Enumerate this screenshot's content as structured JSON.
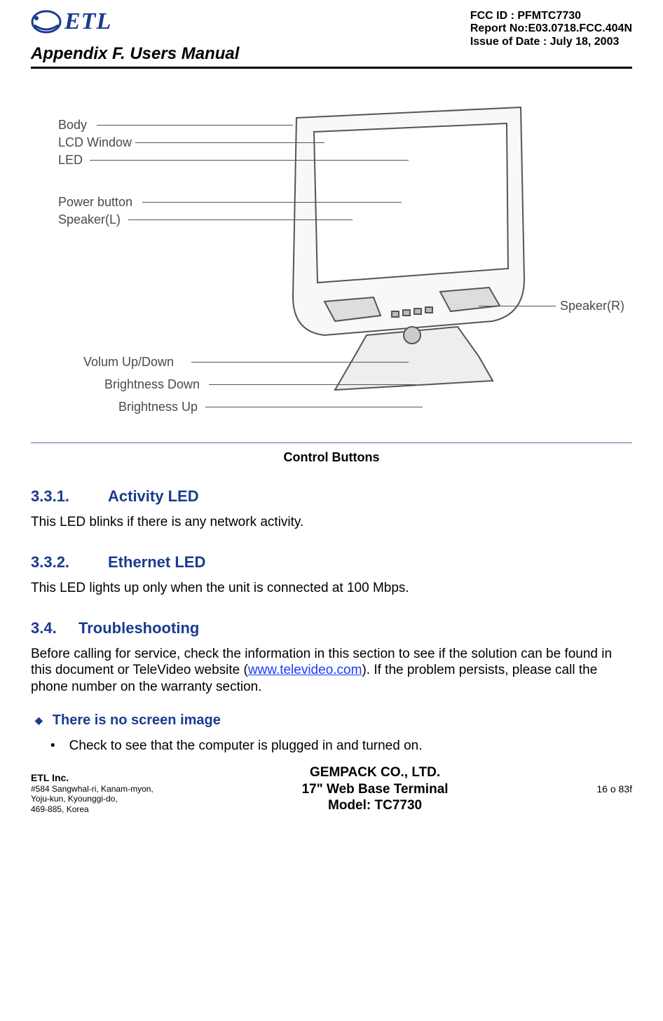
{
  "header": {
    "logo_text": "ETL",
    "fcc_id": "FCC ID : PFMTC7730",
    "report_no": "Report No:E03.0718.FCC.404N",
    "issue_date": "Issue of Date : July 18, 2003",
    "appendix": "Appendix F.  Users Manual"
  },
  "figure": {
    "callouts": {
      "body": "Body",
      "lcd_window": "LCD Window",
      "led": "LED",
      "power_button": "Power button",
      "speaker_l": "Speaker(L)",
      "speaker_r": "Speaker(R)",
      "volume": "Volum Up/Down",
      "bright_down": "Brightness Down",
      "bright_up": "Brightness Up"
    },
    "caption": "Control Buttons"
  },
  "sections": {
    "s331": {
      "num": "3.3.1.",
      "title": "Activity LED",
      "body": "This LED blinks if there is any network activity."
    },
    "s332": {
      "num": "3.3.2.",
      "title": "Ethernet LED",
      "body": "This LED lights up only when the unit is connected at 100 Mbps."
    },
    "s34": {
      "num": "3.4.",
      "title": "Troubleshooting",
      "body_pre": "Before calling for service, check the information in this section to see if the solution can be found in this document or TeleVideo website (",
      "link": "www.televideo.com",
      "body_post": ").  If the problem persists, please call the phone number on the warranty section."
    }
  },
  "bullets": {
    "diamond1": "There is no screen image",
    "dot1": "Check to see that the computer is plugged in and turned on."
  },
  "footer": {
    "company": "ETL Inc.",
    "addr1": "#584 Sangwhal-ri, Kanam-myon,",
    "addr2": "Yoju-kun, Kyounggi-do,",
    "addr3": "469-885, Korea",
    "center1": "GEMPACK CO., LTD.",
    "center2": "17\" Web Base Terminal",
    "center3": "Model: TC7730",
    "page": "16 o 83f"
  }
}
